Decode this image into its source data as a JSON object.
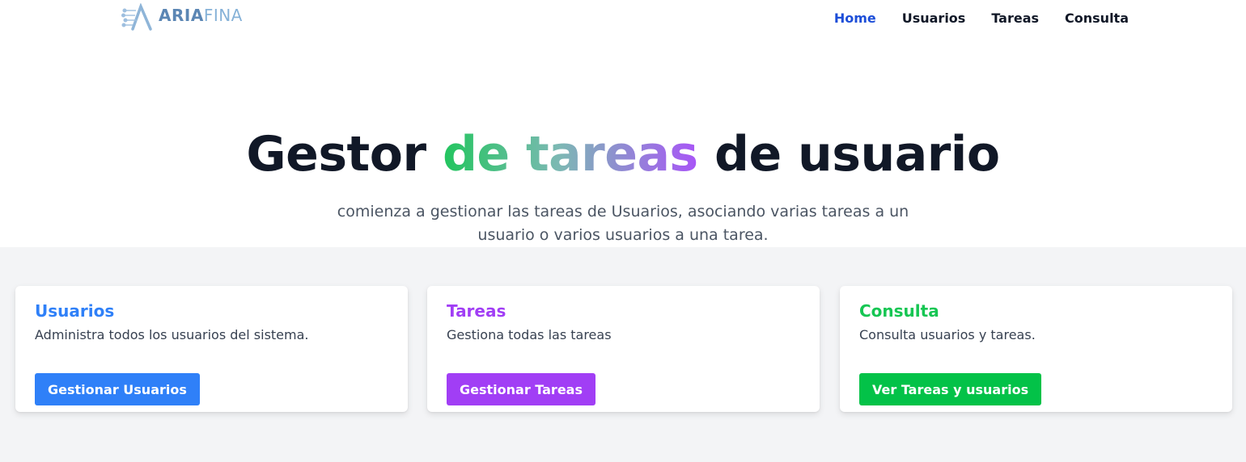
{
  "header": {
    "logo": {
      "part1": "ARIA",
      "part2": "FINA"
    },
    "nav": [
      {
        "label": "Home",
        "active": true
      },
      {
        "label": "Usuarios",
        "active": false
      },
      {
        "label": "Tareas",
        "active": false
      },
      {
        "label": "Consulta",
        "active": false
      }
    ]
  },
  "hero": {
    "title_start": "Gestor ",
    "title_highlight": "de tareas",
    "title_end": " de usuario",
    "subtitle": "comienza a gestionar las tareas de Usuarios, asociando varias tareas a un usuario o varios usuarios a una tarea."
  },
  "cards": [
    {
      "title": "Usuarios",
      "description": "Administra todos los usuarios del sistema.",
      "button": "Gestionar Usuarios",
      "color": "#2f80f8"
    },
    {
      "title": "Tareas",
      "description": "Gestiona todas las tareas",
      "button": "Gestionar Tareas",
      "color": "#a13ef5"
    },
    {
      "title": "Consulta",
      "description": "Consulta usuarios y tareas.",
      "button": "Ver Tareas y usuarios",
      "color": "#03c248"
    }
  ],
  "colors": {
    "nav_active": "#1d4ed8",
    "text_dark": "#111827",
    "section_bg": "#f3f4f6",
    "gradient": [
      "#22c55e",
      "#7cb9b3",
      "#a855f7"
    ]
  }
}
